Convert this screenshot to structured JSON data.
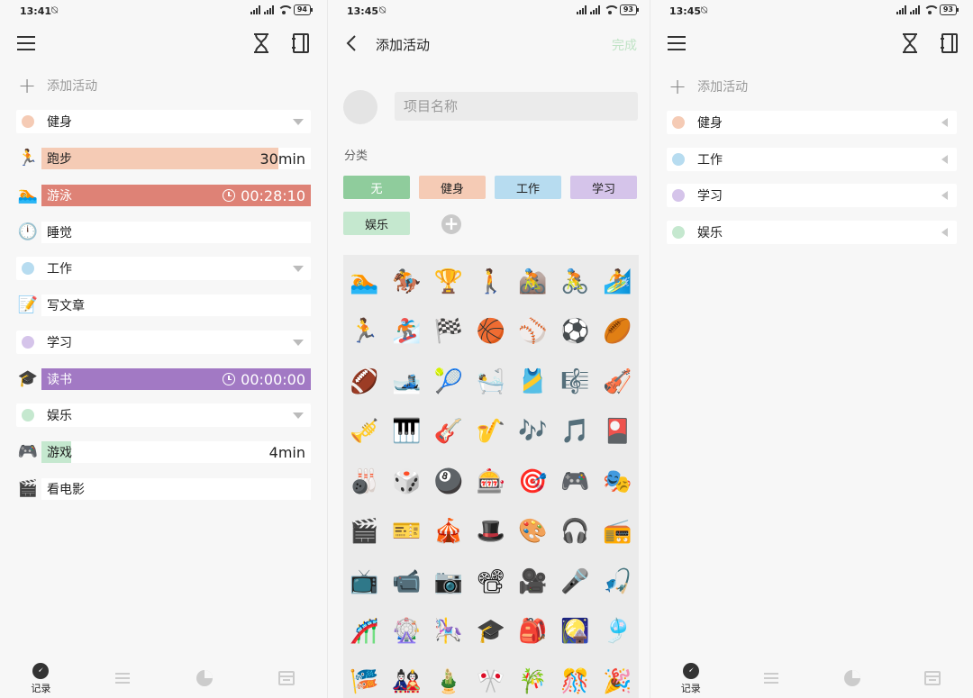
{
  "screen1": {
    "status": {
      "time": "13:41",
      "battery": "94"
    },
    "add_label": "添加活动",
    "categories": [
      {
        "label": "健身",
        "color": "#f5cbb5"
      },
      {
        "label": "工作",
        "color": "#b7dcf0"
      },
      {
        "label": "学习",
        "color": "#d5c4ea"
      },
      {
        "label": "娱乐",
        "color": "#c5e8cf"
      }
    ],
    "activities": {
      "running": {
        "emoji": "🏃",
        "label": "跑步",
        "value": "30min",
        "fill_color": "#f5cbb5",
        "fill": 0.88
      },
      "swimming": {
        "emoji": "🏊",
        "label": "游泳",
        "value": "00:28:10",
        "fill_color": "#de8276",
        "fill": 1.0
      },
      "sleep": {
        "emoji": "🕛",
        "label": "睡觉"
      },
      "writing": {
        "emoji": "📝",
        "label": "写文章"
      },
      "reading": {
        "emoji": "🎓",
        "label": "读书",
        "value": "00:00:00",
        "fill_color": "#a279c4",
        "fill": 1.0
      },
      "gaming": {
        "emoji": "🎮",
        "label": "游戏",
        "value": "4min",
        "fill_color": "#c5e8cf",
        "fill": 0.11
      },
      "movie": {
        "emoji": "🎬",
        "label": "看电影"
      }
    },
    "nav": {
      "record_label": "记录"
    }
  },
  "screen2": {
    "status": {
      "time": "13:45",
      "battery": "93"
    },
    "title": "添加活动",
    "done_label": "完成",
    "name_placeholder": "项目名称",
    "category_section": "分类",
    "chips": [
      {
        "label": "无",
        "color": "#8fcc9c",
        "text_color": "#ffffff"
      },
      {
        "label": "健身",
        "color": "#f5cbb5",
        "text_color": "#222222"
      },
      {
        "label": "工作",
        "color": "#b7dcf0",
        "text_color": "#222222"
      },
      {
        "label": "学习",
        "color": "#d5c4ea",
        "text_color": "#222222"
      },
      {
        "label": "娱乐",
        "color": "#c5e8cf",
        "text_color": "#222222"
      }
    ],
    "emojis": [
      "🏊",
      "🏇",
      "🏆",
      "🚶",
      "🚵",
      "🚴",
      "🏄",
      "🏃",
      "🏂",
      "🏁",
      "🏀",
      "⚾",
      "⚽",
      "🏉",
      "🏈",
      "🎿",
      "🎾",
      "🛀",
      "🎽",
      "🎼",
      "🎻",
      "🎺",
      "🎹",
      "🎸",
      "🎷",
      "🎶",
      "🎵",
      "🎴",
      "🎳",
      "🎲",
      "🎱",
      "🎰",
      "🎯",
      "🎮",
      "🎭",
      "🎬",
      "🎫",
      "🎪",
      "🎩",
      "🎨",
      "🎧",
      "📻",
      "📺",
      "📹",
      "📷",
      "📽",
      "🎥",
      "🎤",
      "🎣",
      "🎢",
      "🎡",
      "🎠",
      "🎓",
      "🎒",
      "🎑",
      "🎐",
      "🎏",
      "🎎",
      "🎍",
      "🎌",
      "🎋",
      "🎊",
      "🎉"
    ]
  },
  "screen3": {
    "status": {
      "time": "13:45",
      "battery": "93"
    },
    "add_label": "添加活动",
    "categories": [
      {
        "label": "健身",
        "color": "#f5cbb5"
      },
      {
        "label": "工作",
        "color": "#b7dcf0"
      },
      {
        "label": "学习",
        "color": "#d5c4ea"
      },
      {
        "label": "娱乐",
        "color": "#c5e8cf"
      }
    ],
    "nav": {
      "record_label": "记录"
    }
  }
}
